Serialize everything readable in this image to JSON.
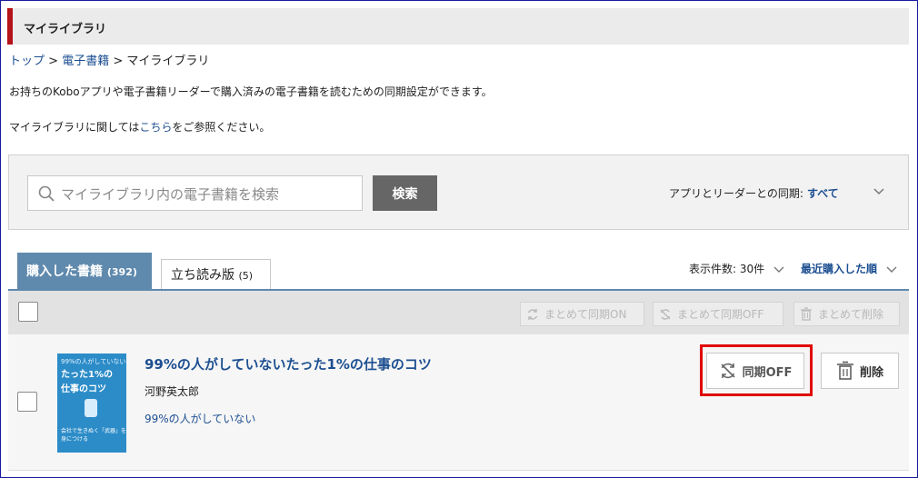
{
  "page": {
    "title": "マイライブラリ"
  },
  "breadcrumb": {
    "items": [
      "トップ",
      "電子書籍",
      "マイライブラリ"
    ],
    "separator": ">"
  },
  "description": {
    "line1": "お持ちのKoboアプリや電子書籍リーダーで購入済みの電子書籍を読むための同期設定ができます。",
    "line2_prefix": "マイライブラリに関しては",
    "line2_link": "こちら",
    "line2_suffix": "をご参照ください。"
  },
  "search": {
    "placeholder": "マイライブラリ内の電子書籍を検索",
    "value": "",
    "button_label": "検索"
  },
  "sync_filter": {
    "label": "アプリとリーダーとの同期:",
    "value": "すべて"
  },
  "tabs": [
    {
      "label": "購入した書籍",
      "count": "(392)",
      "active": true
    },
    {
      "label": "立ち読み版",
      "count": "(5)",
      "active": false
    }
  ],
  "list_controls": {
    "per_page": "表示件数: 30件",
    "sort": "最近購入した順"
  },
  "bulk_actions": {
    "sync_on": "まとめて同期ON",
    "sync_off": "まとめて同期OFF",
    "delete": "まとめて削除"
  },
  "book": {
    "title": "99%の人がしていないたった1%の仕事のコツ",
    "author": "河野英太郎",
    "series": "99%の人がしていない",
    "cover": {
      "line1": "99%の人がしていない",
      "line2": "たった1%の",
      "line3": "仕事のコツ",
      "line4": "会社で生きぬく「武器」を身につける"
    },
    "sync_button": "同期OFF",
    "delete_button": "削除"
  },
  "colors": {
    "accent_red": "#b4131a",
    "link_blue": "#1d4f91",
    "tab_blue": "#5f89ad",
    "highlight_red": "#e00000"
  }
}
